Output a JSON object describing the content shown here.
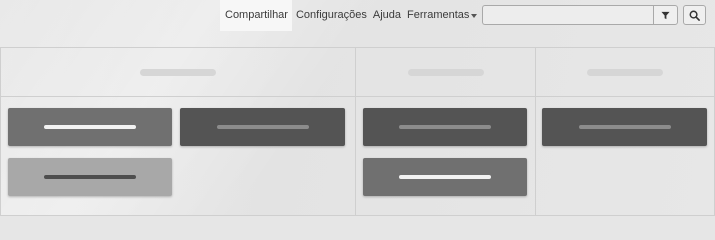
{
  "top_nav": {
    "items": [
      {
        "label": "Compartilhar",
        "active": true
      },
      {
        "label": "Configurações",
        "active": false
      },
      {
        "label": "Ajuda",
        "active": false
      },
      {
        "label": "Ferramentas",
        "active": false,
        "has_dropdown": true
      }
    ]
  },
  "search": {
    "value": "",
    "placeholder": "",
    "filter_icon": "filter-icon",
    "search_icon": "search-icon"
  },
  "columns": [
    {
      "header": "",
      "header_placeholder": true
    },
    {
      "header": "",
      "header_placeholder": true
    },
    {
      "header": "",
      "header_placeholder": true
    }
  ],
  "cards": [
    {
      "column": 1,
      "label": "",
      "tone": "medium",
      "bar_tone": "white"
    },
    {
      "column": 1,
      "label": "",
      "tone": "dark",
      "bar_tone": "grey"
    },
    {
      "column": 1,
      "label": "",
      "tone": "light",
      "bar_tone": "dark"
    },
    {
      "column": 2,
      "label": "",
      "tone": "dark",
      "bar_tone": "grey"
    },
    {
      "column": 2,
      "label": "",
      "tone": "medium",
      "bar_tone": "white"
    },
    {
      "column": 3,
      "label": "",
      "tone": "dark",
      "bar_tone": "grey"
    }
  ],
  "colors": {
    "card_dark": "#545454",
    "card_medium": "#707070",
    "card_light": "#a8a8a8",
    "bar_white": "#f2f2f2",
    "bar_grey": "#8c8c8c",
    "bar_dark": "#4e4e4e",
    "grid_line": "#cfcfcf"
  }
}
